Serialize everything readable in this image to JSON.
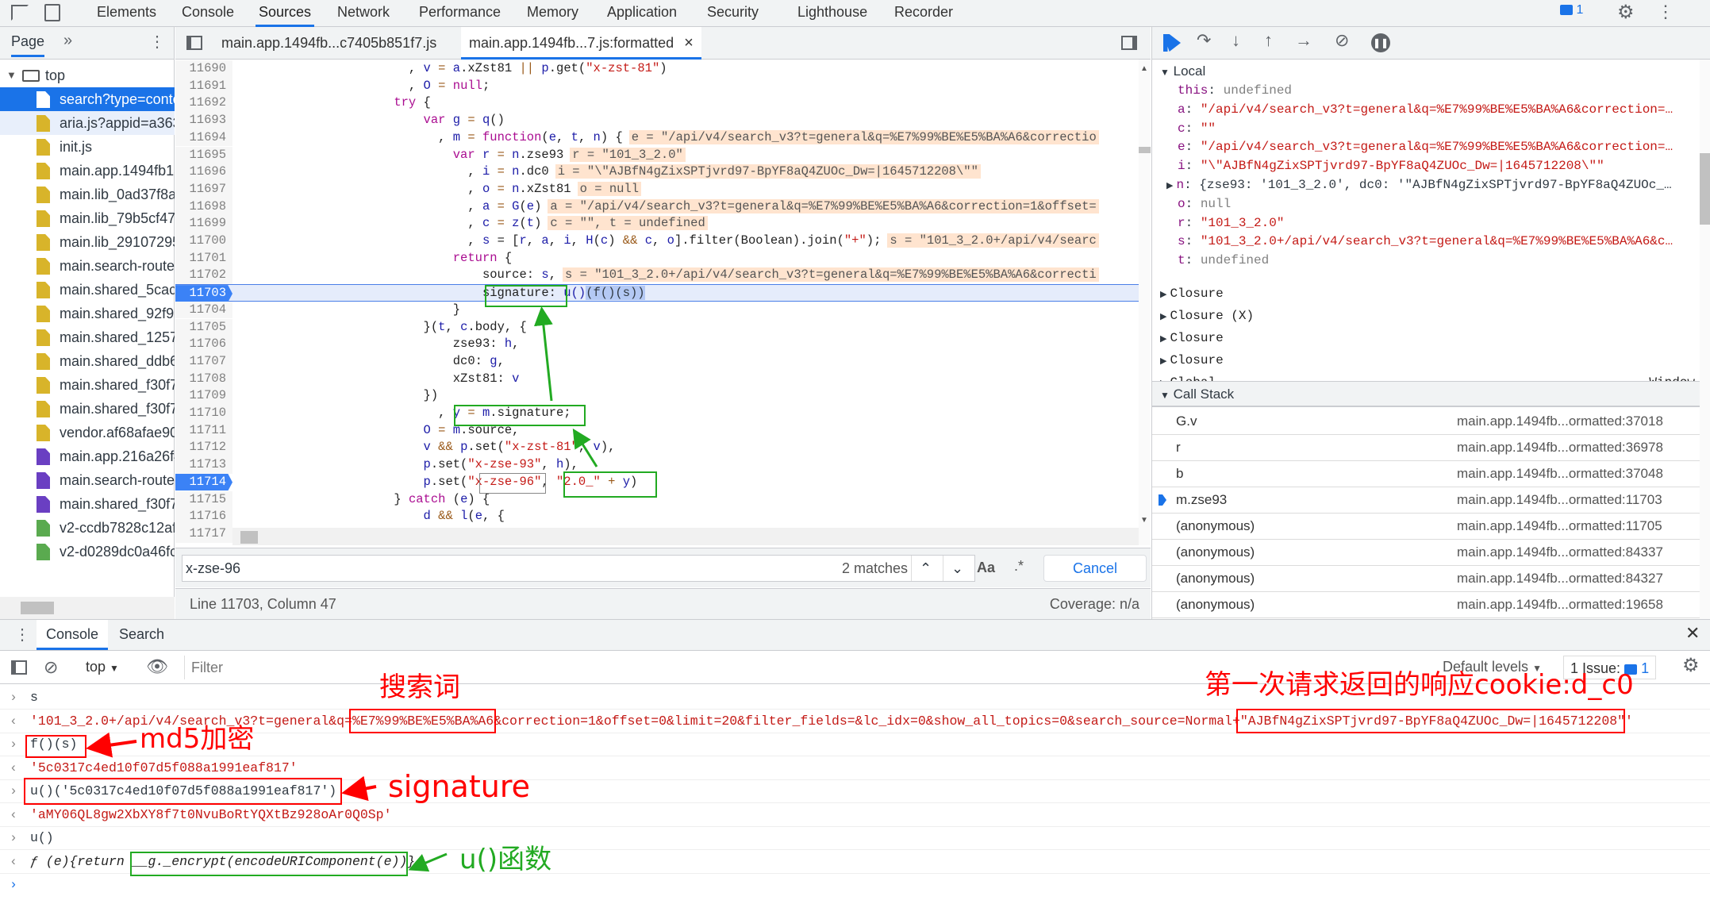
{
  "top_tabs": [
    "Elements",
    "Console",
    "Sources",
    "Network",
    "Performance",
    "Memory",
    "Application",
    "Security",
    "Lighthouse",
    "Recorder"
  ],
  "active_top_tab": "Sources",
  "issues_badge": "1",
  "navigator": {
    "tab": "Page",
    "more": "»",
    "root": "top",
    "files": [
      {
        "name": "search?type=conte",
        "color": "#ffffff",
        "selected": true
      },
      {
        "name": "aria.js?appid=a363",
        "color": "#d8b42a"
      },
      {
        "name": "init.js",
        "color": "#d8b42a"
      },
      {
        "name": "main.app.1494fb18",
        "color": "#d8b42a"
      },
      {
        "name": "main.lib_0ad37f8a.",
        "color": "#d8b42a"
      },
      {
        "name": "main.lib_79b5cf47.",
        "color": "#d8b42a"
      },
      {
        "name": "main.lib_29107295",
        "color": "#d8b42a"
      },
      {
        "name": "main.search-routes",
        "color": "#d8b42a"
      },
      {
        "name": "main.shared_5cac3",
        "color": "#d8b42a"
      },
      {
        "name": "main.shared_92f99",
        "color": "#d8b42a"
      },
      {
        "name": "main.shared_1257c",
        "color": "#d8b42a"
      },
      {
        "name": "main.shared_ddb6",
        "color": "#d8b42a"
      },
      {
        "name": "main.shared_f30f7",
        "color": "#d8b42a"
      },
      {
        "name": "main.shared_f30f7",
        "color": "#d8b42a"
      },
      {
        "name": "vendor.af68afae90",
        "color": "#d8b42a"
      },
      {
        "name": "main.app.216a26f4",
        "color": "#6a3fc2"
      },
      {
        "name": "main.search-routes",
        "color": "#6a3fc2"
      },
      {
        "name": "main.shared_f30f7",
        "color": "#6a3fc2"
      },
      {
        "name": "v2-ccdb7828c12af",
        "color": "#5aaa4f"
      },
      {
        "name": "v2-d0289dc0a46fc",
        "color": "#5aaa4f"
      }
    ]
  },
  "editor": {
    "tabs": [
      "main.app.1494fb...c7405b851f7.js",
      "main.app.1494fb...7.js:formatted"
    ],
    "close": "×",
    "lines": [
      {
        "n": "11690",
        "tokens": [
          [
            "                       , ",
            "p"
          ],
          [
            "v",
            "v"
          ],
          [
            " = ",
            "op"
          ],
          [
            "a",
            "v"
          ],
          [
            ".xZst81 ",
            "p"
          ],
          [
            "||",
            "op"
          ],
          [
            " p",
            "v"
          ],
          [
            ".get(",
            "p"
          ],
          [
            "\"x-zst-81\"",
            "s"
          ],
          [
            ")",
            "p"
          ]
        ]
      },
      {
        "n": "11691",
        "tokens": [
          [
            "                       , ",
            "p"
          ],
          [
            "O",
            "v"
          ],
          [
            " = ",
            "op"
          ],
          [
            "null",
            "kw"
          ],
          [
            ";",
            "p"
          ]
        ]
      },
      {
        "n": "11692",
        "tokens": [
          [
            "                     try",
            "kw"
          ],
          [
            " {",
            "p"
          ]
        ]
      },
      {
        "n": "11693",
        "tokens": [
          [
            "                         var",
            "kw"
          ],
          [
            " g",
            "v"
          ],
          [
            " = ",
            "op"
          ],
          [
            "q",
            "v"
          ],
          [
            "()",
            "p"
          ]
        ]
      },
      {
        "n": "11694",
        "tokens": [
          [
            "                           , ",
            "p"
          ],
          [
            "m",
            "v"
          ],
          [
            " = ",
            "op"
          ],
          [
            "function",
            "kw"
          ],
          [
            "(",
            "p"
          ],
          [
            "e",
            "v"
          ],
          [
            ", ",
            "p"
          ],
          [
            "t",
            "v"
          ],
          [
            ", ",
            "p"
          ],
          [
            "n",
            "v"
          ],
          [
            ") {",
            "p"
          ],
          [
            "e = \"/api/v4/search_v3?t=general&q=%E7%99%BE%E5%BA%A6&correctio",
            "val"
          ]
        ]
      },
      {
        "n": "11695",
        "tokens": [
          [
            "                             var",
            "kw"
          ],
          [
            " r",
            "v"
          ],
          [
            " = ",
            "op"
          ],
          [
            "n",
            "v"
          ],
          [
            ".zse93",
            "p"
          ],
          [
            "r = \"101_3_2.0\"",
            "val"
          ]
        ]
      },
      {
        "n": "11696",
        "tokens": [
          [
            "                               , ",
            "p"
          ],
          [
            "i",
            "v"
          ],
          [
            " = ",
            "op"
          ],
          [
            "n",
            "v"
          ],
          [
            ".dc0",
            "p"
          ],
          [
            "i = \"\\\"AJBfN4gZixSPTjvrd97-BpYF8aQ4ZUOc_Dw=|1645712208\\\"\"",
            "val"
          ]
        ]
      },
      {
        "n": "11697",
        "tokens": [
          [
            "                               , ",
            "p"
          ],
          [
            "o",
            "v"
          ],
          [
            " = ",
            "op"
          ],
          [
            "n",
            "v"
          ],
          [
            ".xZst81",
            "p"
          ],
          [
            "o = null",
            "val"
          ]
        ]
      },
      {
        "n": "11698",
        "tokens": [
          [
            "                               , ",
            "p"
          ],
          [
            "a",
            "v"
          ],
          [
            " = ",
            "op"
          ],
          [
            "G",
            "v"
          ],
          [
            "(",
            "p"
          ],
          [
            "e",
            "v"
          ],
          [
            ")",
            "p"
          ],
          [
            "a = \"/api/v4/search_v3?t=general&q=%E7%99%BE%E5%BA%A6&correction=1&offset=",
            "val"
          ]
        ]
      },
      {
        "n": "11699",
        "tokens": [
          [
            "                               , ",
            "p"
          ],
          [
            "c",
            "v"
          ],
          [
            " = ",
            "op"
          ],
          [
            "z",
            "v"
          ],
          [
            "(",
            "p"
          ],
          [
            "t",
            "v"
          ],
          [
            ")",
            "p"
          ],
          [
            "c = \"\", t = undefined",
            "val"
          ]
        ]
      },
      {
        "n": "11700",
        "tokens": [
          [
            "                               , ",
            "p"
          ],
          [
            "s",
            "v"
          ],
          [
            " = [",
            "p"
          ],
          [
            "r",
            "v"
          ],
          [
            ", ",
            "p"
          ],
          [
            "a",
            "v"
          ],
          [
            ", ",
            "p"
          ],
          [
            "i",
            "v"
          ],
          [
            ", ",
            "p"
          ],
          [
            "H",
            "v"
          ],
          [
            "(",
            "p"
          ],
          [
            "c",
            "v"
          ],
          [
            ") ",
            "p"
          ],
          [
            "&&",
            "op"
          ],
          [
            " c",
            "v"
          ],
          [
            ", ",
            "p"
          ],
          [
            "o",
            "v"
          ],
          [
            "].filter(Boolean).join(",
            "p"
          ],
          [
            "\"+\"",
            "s"
          ],
          [
            ");",
            "p"
          ],
          [
            "s = \"101_3_2.0+/api/v4/searc",
            "val"
          ]
        ]
      },
      {
        "n": "11701",
        "tokens": [
          [
            "                             return",
            "kw"
          ],
          [
            " {",
            "p"
          ]
        ]
      },
      {
        "n": "11702",
        "tokens": [
          [
            "                                 source: ",
            "p"
          ],
          [
            "s",
            "v"
          ],
          [
            ",",
            "p"
          ],
          [
            "s = \"101_3_2.0+/api/v4/search_v3?t=general&q=%E7%99%BE%E5%BA%A6&correcti",
            "val"
          ]
        ]
      },
      {
        "n": "11703",
        "current": true,
        "tokens": [
          [
            "                                 signature: ",
            "p"
          ],
          [
            "u()",
            "v"
          ],
          [
            "(f()(s))",
            "hl"
          ]
        ]
      },
      {
        "n": "11704",
        "tokens": [
          [
            "                             }",
            "p"
          ]
        ]
      },
      {
        "n": "11705",
        "tokens": [
          [
            "                         }(",
            "p"
          ],
          [
            "t",
            "v"
          ],
          [
            ", ",
            "p"
          ],
          [
            "c",
            "v"
          ],
          [
            ".body, {",
            "p"
          ]
        ]
      },
      {
        "n": "11706",
        "tokens": [
          [
            "                             zse93: ",
            "p"
          ],
          [
            "h",
            "v"
          ],
          [
            ",",
            "p"
          ]
        ]
      },
      {
        "n": "11707",
        "tokens": [
          [
            "                             dc0: ",
            "p"
          ],
          [
            "g",
            "v"
          ],
          [
            ",",
            "p"
          ]
        ]
      },
      {
        "n": "11708",
        "tokens": [
          [
            "                             xZst81: ",
            "p"
          ],
          [
            "v",
            "v"
          ]
        ]
      },
      {
        "n": "11709",
        "tokens": [
          [
            "                         })",
            "p"
          ]
        ]
      },
      {
        "n": "11710",
        "tokens": [
          [
            "                           , ",
            "p"
          ],
          [
            "y",
            "v"
          ],
          [
            " = ",
            "op"
          ],
          [
            "m",
            "v"
          ],
          [
            ".signature;",
            "p"
          ]
        ]
      },
      {
        "n": "11711",
        "tokens": [
          [
            "                         O",
            "v"
          ],
          [
            " = ",
            "op"
          ],
          [
            "m",
            "v"
          ],
          [
            ".source,",
            "p"
          ]
        ]
      },
      {
        "n": "11712",
        "tokens": [
          [
            "                         v",
            "v"
          ],
          [
            " && ",
            "op"
          ],
          [
            "p",
            "v"
          ],
          [
            ".set(",
            "p"
          ],
          [
            "\"x-zst-81\"",
            "s"
          ],
          [
            ", ",
            "p"
          ],
          [
            "v",
            "v"
          ],
          [
            "),",
            "p"
          ]
        ]
      },
      {
        "n": "11713",
        "tokens": [
          [
            "                         p",
            "v"
          ],
          [
            ".set(",
            "p"
          ],
          [
            "\"x-zse-93\"",
            "s"
          ],
          [
            ", ",
            "p"
          ],
          [
            "h",
            "v"
          ],
          [
            "),",
            "p"
          ]
        ]
      },
      {
        "n": "11714",
        "breakpoint": true,
        "tokens": [
          [
            "                         p",
            "v"
          ],
          [
            ".set(",
            "p"
          ],
          [
            "\"x-zse-96\"",
            "s"
          ],
          [
            ", ",
            "p"
          ],
          [
            "\"2.0_\"",
            "s"
          ],
          [
            " + ",
            "op"
          ],
          [
            "y",
            "v"
          ],
          [
            ")",
            "p"
          ]
        ]
      },
      {
        "n": "11715",
        "tokens": [
          [
            "                     } ",
            "p"
          ],
          [
            "catch",
            "kw"
          ],
          [
            " (",
            "p"
          ],
          [
            "e",
            "v"
          ],
          [
            ") {",
            "p"
          ]
        ]
      },
      {
        "n": "11716",
        "tokens": [
          [
            "                         d",
            "v"
          ],
          [
            " && ",
            "op"
          ],
          [
            "l",
            "v"
          ],
          [
            "(",
            "p"
          ],
          [
            "e",
            "v"
          ],
          [
            ", {",
            "p"
          ]
        ]
      },
      {
        "n": "11717",
        "tokens": []
      }
    ]
  },
  "search": {
    "value": "x-zse-96",
    "matches": "2 matches",
    "match_case": "Aa",
    "regex": ".*",
    "cancel": "Cancel"
  },
  "status": {
    "position": "Line 11703, Column 47",
    "coverage": "Coverage: n/a"
  },
  "scope": {
    "local_label": "Local",
    "local": [
      {
        "k": "this",
        "v": "undefined",
        "type": "g"
      },
      {
        "k": "a",
        "v": "\"/api/v4/search_v3?t=general&q=%E7%99%BE%E5%BA%A6&correction=…",
        "type": "s"
      },
      {
        "k": "c",
        "v": "\"\"",
        "type": "s"
      },
      {
        "k": "e",
        "v": "\"/api/v4/search_v3?t=general&q=%E7%99%BE%E5%BA%A6&correction=…",
        "type": "s"
      },
      {
        "k": "i",
        "v": "\"\\\"AJBfN4gZixSPTjvrd97-BpYF8aQ4ZUOc_Dw=|1645712208\\\"\"",
        "type": "s"
      },
      {
        "k": "n",
        "v": "{zse93: '101_3_2.0', dc0: '\"AJBfN4gZixSPTjvrd97-BpYF8aQ4ZUOc_…",
        "type": "o"
      },
      {
        "k": "o",
        "v": "null",
        "type": "g"
      },
      {
        "k": "r",
        "v": "\"101_3_2.0\"",
        "type": "s"
      },
      {
        "k": "s",
        "v": "\"101_3_2.0+/api/v4/search_v3?t=general&q=%E7%99%BE%E5%BA%A6&c…",
        "type": "s"
      },
      {
        "k": "t",
        "v": "undefined",
        "type": "g"
      }
    ],
    "closures": [
      "Closure",
      "Closure (X)",
      "Closure",
      "Closure"
    ],
    "global_label": "Global",
    "global_value": "Window"
  },
  "call_stack": {
    "label": "Call Stack",
    "frames": [
      {
        "fn": "G.v",
        "loc": "main.app.1494fb...ormatted:37018"
      },
      {
        "fn": "r",
        "loc": "main.app.1494fb...ormatted:36978"
      },
      {
        "fn": "b",
        "loc": "main.app.1494fb...ormatted:37048"
      },
      {
        "fn": "m.zse93",
        "loc": "main.app.1494fb...ormatted:11703",
        "current": true
      },
      {
        "fn": "(anonymous)",
        "loc": "main.app.1494fb...ormatted:11705"
      },
      {
        "fn": "(anonymous)",
        "loc": "main.app.1494fb...ormatted:84337"
      },
      {
        "fn": "(anonymous)",
        "loc": "main.app.1494fb...ormatted:84327"
      },
      {
        "fn": "(anonymous)",
        "loc": "main.app.1494fb...ormatted:19658"
      }
    ]
  },
  "drawer": {
    "tabs": [
      "Console",
      "Search"
    ],
    "context": "top",
    "filter_placeholder": "Filter",
    "levels": "Default levels",
    "issues": "1 Issue:",
    "issues_count": "1"
  },
  "console": [
    {
      "kind": "in",
      "text": "s"
    },
    {
      "kind": "out",
      "text": "'101_3_2.0+/api/v4/search_v3?t=general&q=%E7%99%BE%E5%BA%A6&correction=1&offset=0&limit=20&filter_fields=&lc_idx=0&show_all_topics=0&search_source=Normal+\"AJBfN4gZixSPTjvrd97-BpYF8aQ4ZUOc_Dw=|1645712208\"'",
      "color": "#c41a16"
    },
    {
      "kind": "in",
      "text": "f()(s)"
    },
    {
      "kind": "out",
      "text": "'5c0317c4ed10f07d5f088a1991eaf817'",
      "color": "#c41a16"
    },
    {
      "kind": "in",
      "text": "u()('5c0317c4ed10f07d5f088a1991eaf817')"
    },
    {
      "kind": "out",
      "text": "'aMY06QL8gw2XbXY8f7t0NvuBoRtYQXtBz928oAr0Q0Sp'",
      "color": "#c41a16"
    },
    {
      "kind": "in",
      "text": "u()"
    },
    {
      "kind": "out",
      "text": "ƒ (e){return __g._encrypt(encodeURIComponent(e))}",
      "color": "#222",
      "italic": true
    }
  ],
  "annotations": {
    "search_word": "搜索词",
    "cookie": "第一次请求返回的响应cookie:d_c0",
    "md5": "md5加密",
    "signature": "signature",
    "u_func": "u()函数",
    "red": "#ff0000",
    "green": "#22aa22"
  }
}
